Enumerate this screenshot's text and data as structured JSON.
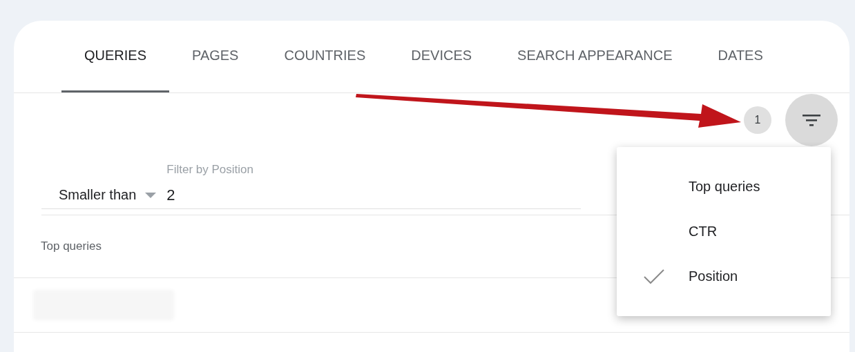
{
  "tabs": [
    {
      "label": "QUERIES",
      "selected": true
    },
    {
      "label": "PAGES",
      "selected": false
    },
    {
      "label": "COUNTRIES",
      "selected": false
    },
    {
      "label": "DEVICES",
      "selected": false
    },
    {
      "label": "SEARCH APPEARANCE",
      "selected": false
    },
    {
      "label": "DATES",
      "selected": false
    }
  ],
  "filter_count": "1",
  "filter": {
    "label": "Filter by Position",
    "operator": "Smaller than",
    "value": "2"
  },
  "table": {
    "columns": [
      "Top queries"
    ]
  },
  "menu": {
    "items": [
      {
        "label": "Top queries",
        "checked": false
      },
      {
        "label": "CTR",
        "checked": false
      },
      {
        "label": "Position",
        "checked": true
      }
    ]
  }
}
